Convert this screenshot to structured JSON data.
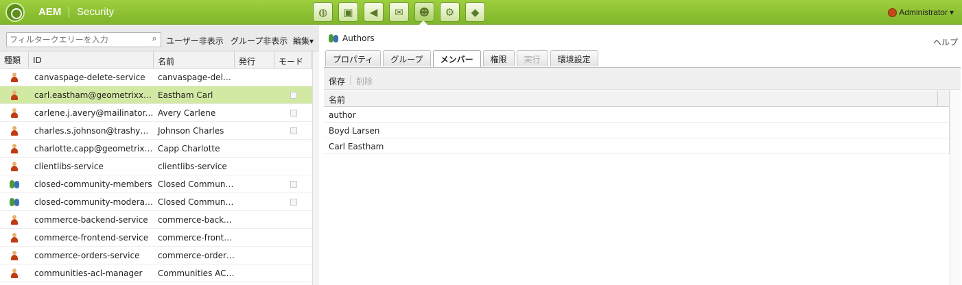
{
  "header": {
    "brand": "AEM",
    "section": "Security",
    "user": "Administrator",
    "nav_icons": [
      "globe-icon",
      "camera-icon",
      "megaphone-icon",
      "mail-icon",
      "users-icon",
      "gear-icon",
      "tag-icon"
    ]
  },
  "left_toolbar": {
    "filter_placeholder": "フィルタークエリーを入力",
    "hide_users": "ユーザー非表示",
    "hide_groups": "グループ非表示",
    "edit": "編集"
  },
  "left_grid": {
    "columns": [
      "種類",
      "ID",
      "名前",
      "発行",
      "モード"
    ],
    "rows": [
      {
        "type": "user",
        "id": "canvaspage-delete-service",
        "name": "canvaspage-delet...",
        "checkbox": false
      },
      {
        "type": "user",
        "id": "carl.eastham@geometrixx-me...",
        "name": "Eastham Carl",
        "checkbox": true,
        "selected": true
      },
      {
        "type": "user",
        "id": "carlene.j.avery@mailinator.com",
        "name": "Avery Carlene",
        "checkbox": true
      },
      {
        "type": "user",
        "id": "charles.s.johnson@trashymail...",
        "name": "Johnson Charles",
        "checkbox": true
      },
      {
        "type": "user",
        "id": "charlotte.capp@geometrixx-...",
        "name": "Capp Charlotte",
        "checkbox": false
      },
      {
        "type": "user",
        "id": "clientlibs-service",
        "name": "clientlibs-service",
        "checkbox": false
      },
      {
        "type": "group",
        "id": "closed-community-members",
        "name": "Closed Communit...",
        "checkbox": true
      },
      {
        "type": "group",
        "id": "closed-community-moderators",
        "name": "Closed Communit...",
        "checkbox": true
      },
      {
        "type": "user",
        "id": "commerce-backend-service",
        "name": "commerce-backen...",
        "checkbox": false
      },
      {
        "type": "user",
        "id": "commerce-frontend-service",
        "name": "commerce-fronte...",
        "checkbox": false
      },
      {
        "type": "user",
        "id": "commerce-orders-service",
        "name": "commerce-orders-...",
        "checkbox": false
      },
      {
        "type": "user",
        "id": "communities-acl-manager",
        "name": "Communities ACL ...",
        "checkbox": false
      }
    ]
  },
  "right_panel": {
    "title": "Authors",
    "help": "ヘルプ",
    "tabs": [
      {
        "label": "プロパティ",
        "state": "normal"
      },
      {
        "label": "グループ",
        "state": "normal"
      },
      {
        "label": "メンバー",
        "state": "active"
      },
      {
        "label": "権限",
        "state": "normal"
      },
      {
        "label": "実行",
        "state": "disabled"
      },
      {
        "label": "環境設定",
        "state": "normal"
      }
    ],
    "toolbar": {
      "save": "保存",
      "delete": "削除"
    },
    "members_header": "名前",
    "members": [
      "author",
      "Boyd Larsen",
      "Carl Eastham"
    ]
  }
}
